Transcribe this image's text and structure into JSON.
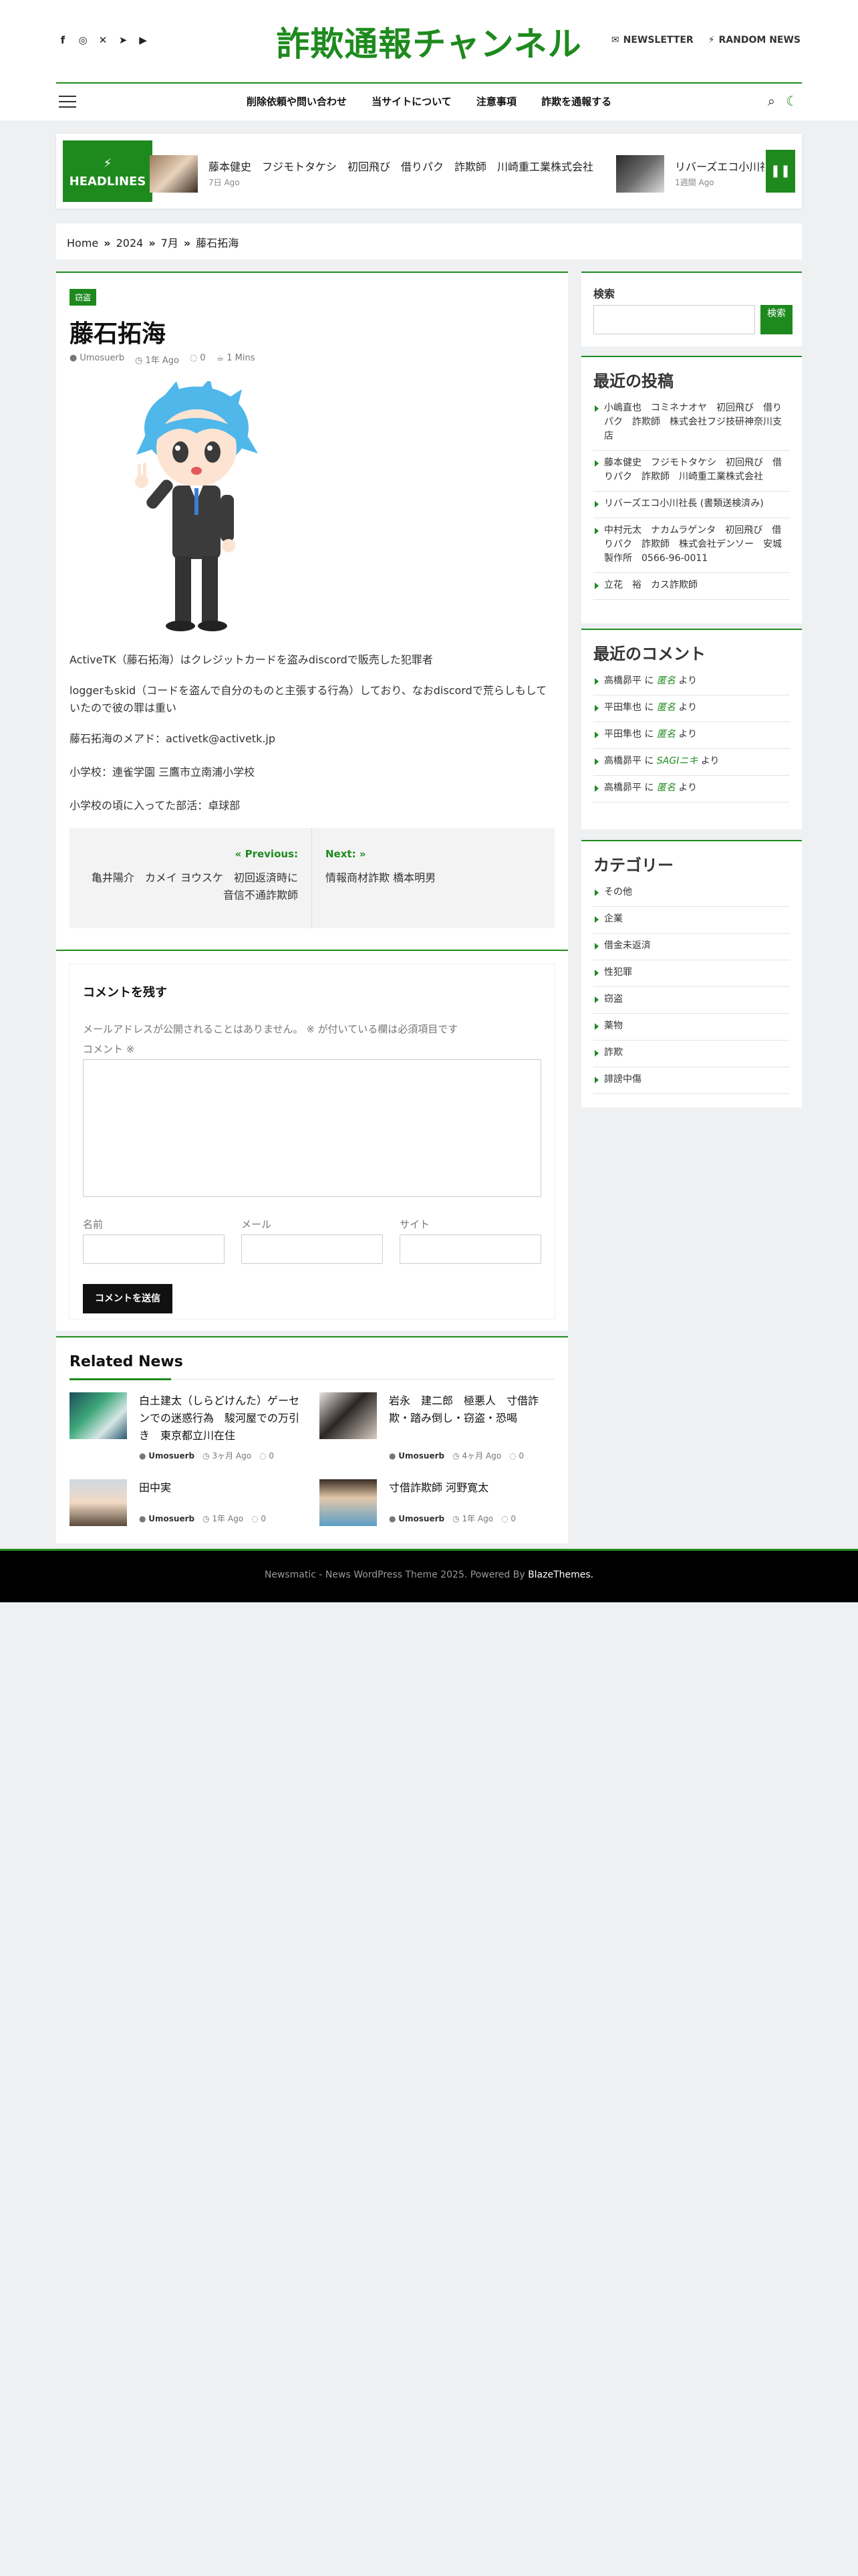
{
  "header": {
    "site_title": "詐欺通報チャンネル",
    "social_icons": [
      "facebook-icon",
      "instagram-icon",
      "x-icon",
      "telegram-icon",
      "youtube-icon"
    ],
    "newsletter": "NEWSLETTER",
    "random_news": "RANDOM NEWS"
  },
  "nav": {
    "items": [
      "削除依頼や問い合わせ",
      "当サイトについて",
      "注意事項",
      "詐欺を通報する"
    ]
  },
  "headlines": {
    "label": "HEADLINES",
    "items": [
      {
        "title": "藤本健史　フジモトタケシ　初回飛び　借りパク　詐欺師　川崎重工業株式会社",
        "date": "7日 Ago"
      },
      {
        "title": "リバーズエコ小川社長 (書類送検済み)",
        "date": "1週間 Ago"
      }
    ]
  },
  "breadcrumb": [
    "Home",
    "2024",
    "7月",
    "藤石拓海"
  ],
  "post": {
    "category": "窃盗",
    "title": "藤石拓海",
    "author": "Umosuerb",
    "date": "1年 Ago",
    "comments": "0",
    "read_time": "1 Mins",
    "paragraphs": [
      "ActiveTK（藤石拓海）はクレジットカードを盗みdiscordで販売した犯罪者",
      "loggerもskid（コードを盗んで自分のものと主張する行為）しており、なおdiscordで荒らしもしていたので彼の罪は重い",
      "藤石拓海のメアド：activetk@activetk.jp",
      "小学校：連雀学園 三鷹市立南浦小学校",
      "小学校の頃に入ってた部活：卓球部"
    ],
    "prev_label": "Previous:",
    "prev_title": "亀井陽介　カメイ ヨウスケ　初回返済時に音信不通詐欺師",
    "next_label": "Next:",
    "next_title": "情報商材詐欺 橋本明男"
  },
  "comment_form": {
    "title": "コメントを残す",
    "note": "メールアドレスが公開されることはありません。 ※ が付いている欄は必須項目です",
    "comment_label": "コメント ※",
    "name_label": "名前",
    "email_label": "メール",
    "site_label": "サイト",
    "submit": "コメントを送信"
  },
  "related": {
    "title": "Related News",
    "items": [
      {
        "title": "白土建太（しらどけんた）ゲーセンでの迷惑行為　駿河屋での万引き　東京都立川在住",
        "author": "Umosuerb",
        "date": "3ヶ月 Ago",
        "comments": "0"
      },
      {
        "title": "岩永　建二郎　極悪人　寸借詐欺・踏み倒し・窃盗・恐喝",
        "author": "Umosuerb",
        "date": "4ヶ月 Ago",
        "comments": "0"
      },
      {
        "title": "田中実",
        "author": "Umosuerb",
        "date": "1年 Ago",
        "comments": "0"
      },
      {
        "title": "寸借詐欺師 河野寛太",
        "author": "Umosuerb",
        "date": "1年 Ago",
        "comments": "0"
      }
    ]
  },
  "sidebar": {
    "search_label": "検索",
    "search_button": "検索",
    "recent_posts_title": "最近の投稿",
    "recent_posts": [
      "小嶋直也　コミネナオヤ　初回飛び　借りパク　詐欺師　株式会社フジ技研神奈川支店",
      "藤本健史　フジモトタケシ　初回飛び　借りパク　詐欺師　川崎重工業株式会社",
      "リバーズエコ小川社長 (書類送検済み)",
      "中村元太　ナカムラゲンタ　初回飛び　借りパク　詐欺師　株式会社デンソー　安城製作所　0566-96-0011",
      "立花　裕　カス詐欺師"
    ],
    "recent_comments_title": "最近のコメント",
    "recent_comments": [
      {
        "author": "高橋昴平",
        "on": "に",
        "post": "匿名",
        "suffix": "より"
      },
      {
        "author": "平田隼也",
        "on": "に",
        "post": "匿名",
        "suffix": "より"
      },
      {
        "author": "平田隼也",
        "on": "に",
        "post": "匿名",
        "suffix": "より"
      },
      {
        "author": "高橋昴平",
        "on": "に",
        "post": "SAGIニキ",
        "suffix": "より"
      },
      {
        "author": "高橋昴平",
        "on": "に",
        "post": "匿名",
        "suffix": "より"
      }
    ],
    "categories_title": "カテゴリー",
    "categories": [
      "その他",
      "企業",
      "借金未返済",
      "性犯罪",
      "窃盗",
      "薬物",
      "詐欺",
      "誹謗中傷"
    ]
  },
  "footer": {
    "text": "Newsmatic - News WordPress Theme 2025. Powered By",
    "link": "BlazeThemes."
  },
  "colors": {
    "accent": "#1e8a1e",
    "footer_bg": "#000000",
    "page_bg": "#eef0f2"
  }
}
